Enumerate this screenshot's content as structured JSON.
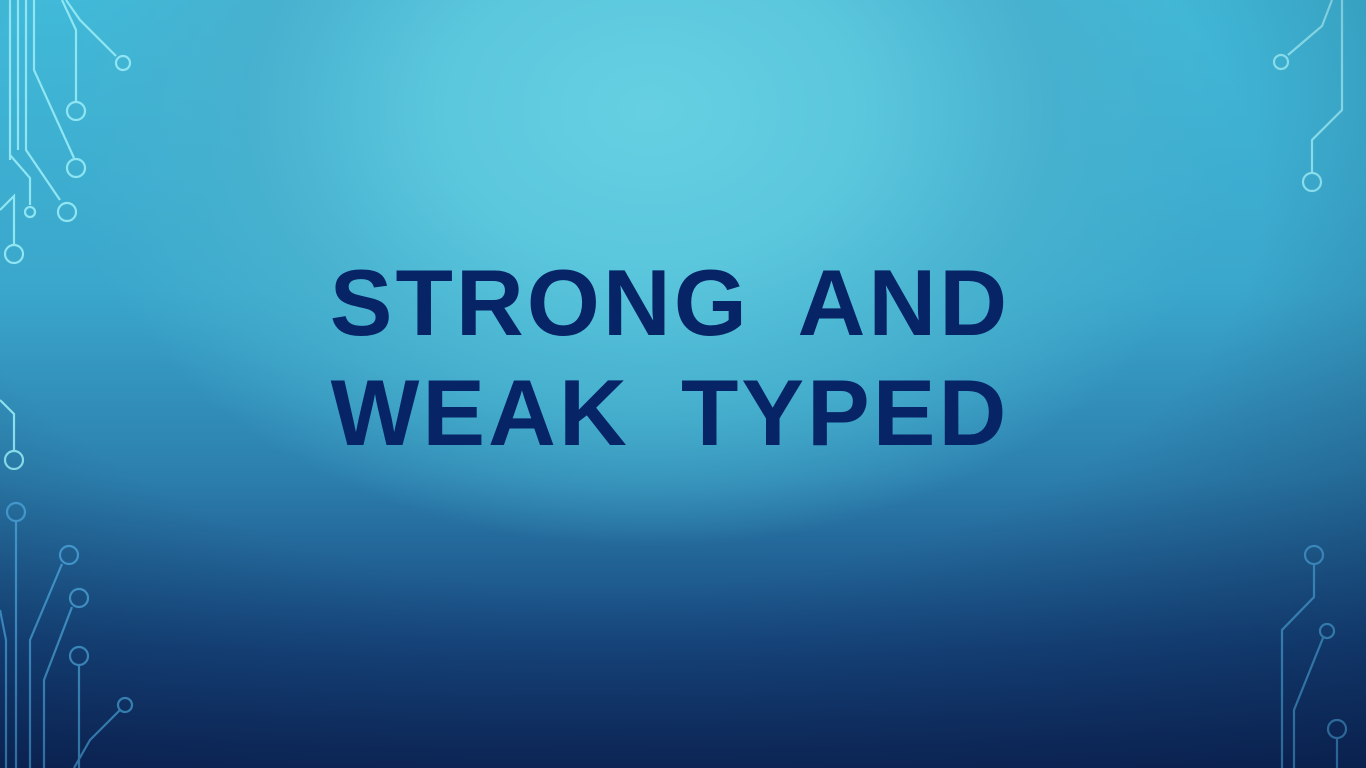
{
  "slide": {
    "title_line1": "STRONG AND",
    "title_line2": "WEAK TYPED"
  },
  "colors": {
    "title_text": "#062466",
    "background_top": "#5bc7dd",
    "background_bottom": "#0f2a5c",
    "circuit_light": "#8fe6f2",
    "circuit_dark": "#3d97d6"
  },
  "decorations": {
    "style": "circuit-lines"
  }
}
